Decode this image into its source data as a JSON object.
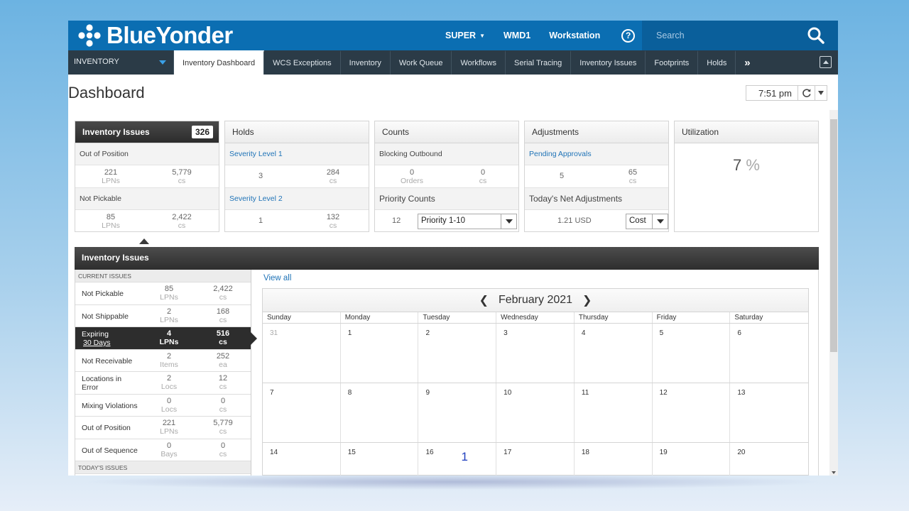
{
  "header": {
    "logo_text": "BlueYonder",
    "nav": [
      {
        "label": "SUPER"
      },
      {
        "label": "WMD1"
      },
      {
        "label": "Workstation"
      }
    ],
    "help_label": "?",
    "search_placeholder": "Search"
  },
  "tabbar": {
    "module": "INVENTORY",
    "tabs": [
      {
        "label": "Inventory Dashboard"
      },
      {
        "label": "WCS Exceptions"
      },
      {
        "label": "Inventory"
      },
      {
        "label": "Work Queue"
      },
      {
        "label": "Workflows"
      },
      {
        "label": "Serial Tracing"
      },
      {
        "label": "Inventory Issues"
      },
      {
        "label": "Footprints"
      },
      {
        "label": "Holds"
      }
    ],
    "more_label": "»"
  },
  "page": {
    "title": "Dashboard",
    "time": "7:51 pm"
  },
  "cards": {
    "inventory_issues": {
      "title": "Inventory Issues",
      "count": "326",
      "sections": [
        {
          "label": "Out of Position",
          "v1": "221",
          "u1": "LPNs",
          "v2": "5,779",
          "u2": "cs"
        },
        {
          "label": "Not Pickable",
          "v1": "85",
          "u1": "LPNs",
          "v2": "2,422",
          "u2": "cs"
        }
      ]
    },
    "holds": {
      "title": "Holds",
      "sections": [
        {
          "label": "Severity Level 1",
          "v1": "3",
          "v2": "284",
          "u2": "cs"
        },
        {
          "label": "Severity Level 2",
          "v1": "1",
          "v2": "132",
          "u2": "cs"
        }
      ]
    },
    "counts": {
      "title": "Counts",
      "blocking_label": "Blocking Outbound",
      "v1": "0",
      "u1": "Orders",
      "v2": "0",
      "u2": "cs",
      "priority_label": "Priority Counts",
      "priority_value": "12",
      "priority_select": "Priority 1-10"
    },
    "adjustments": {
      "title": "Adjustments",
      "pending_label": "Pending Approvals",
      "v1": "5",
      "v2": "65",
      "u2": "cs",
      "net_label": "Today's Net Adjustments",
      "net_value": "1.21 USD",
      "net_select": "Cost"
    },
    "utilization": {
      "title": "Utilization",
      "value": "7",
      "unit": "%"
    }
  },
  "detail": {
    "title": "Inventory Issues",
    "current_label": "CURRENT ISSUES",
    "today_label": "TODAY'S ISSUES",
    "rows": [
      {
        "label": "Not Pickable",
        "v1": "85",
        "u1": "LPNs",
        "v2": "2,422",
        "u2": "cs"
      },
      {
        "label": "Not Shippable",
        "v1": "2",
        "u1": "LPNs",
        "v2": "168",
        "u2": "cs"
      },
      {
        "label": "Expiring",
        "sublabel": "30 Days",
        "v1": "4",
        "u1": "LPNs",
        "v2": "516",
        "u2": "cs"
      },
      {
        "label": "Not Receivable",
        "v1": "2",
        "u1": "Items",
        "v2": "252",
        "u2": "ea"
      },
      {
        "label": "Locations in Error",
        "v1": "2",
        "u1": "Locs",
        "v2": "12",
        "u2": "cs"
      },
      {
        "label": "Mixing Violations",
        "v1": "0",
        "u1": "Locs",
        "v2": "0",
        "u2": "cs"
      },
      {
        "label": "Out of Position",
        "v1": "221",
        "u1": "LPNs",
        "v2": "5,779",
        "u2": "cs"
      },
      {
        "label": "Out of Sequence",
        "v1": "0",
        "u1": "Bays",
        "v2": "0",
        "u2": "cs"
      }
    ],
    "view_all": "View all",
    "calendar": {
      "month": "February 2021",
      "days": [
        "Sunday",
        "Monday",
        "Tuesday",
        "Wednesday",
        "Thursday",
        "Friday",
        "Saturday"
      ],
      "weeks": [
        [
          "31",
          "1",
          "2",
          "3",
          "4",
          "5",
          "6"
        ],
        [
          "7",
          "8",
          "9",
          "10",
          "11",
          "12",
          "13"
        ],
        [
          "14",
          "15",
          "16",
          "17",
          "18",
          "19",
          "20"
        ]
      ],
      "event_count": "1"
    }
  },
  "colors": {
    "brand": "#0b6eb2",
    "tabbar": "#2b3b47",
    "link": "#1f73b7"
  }
}
